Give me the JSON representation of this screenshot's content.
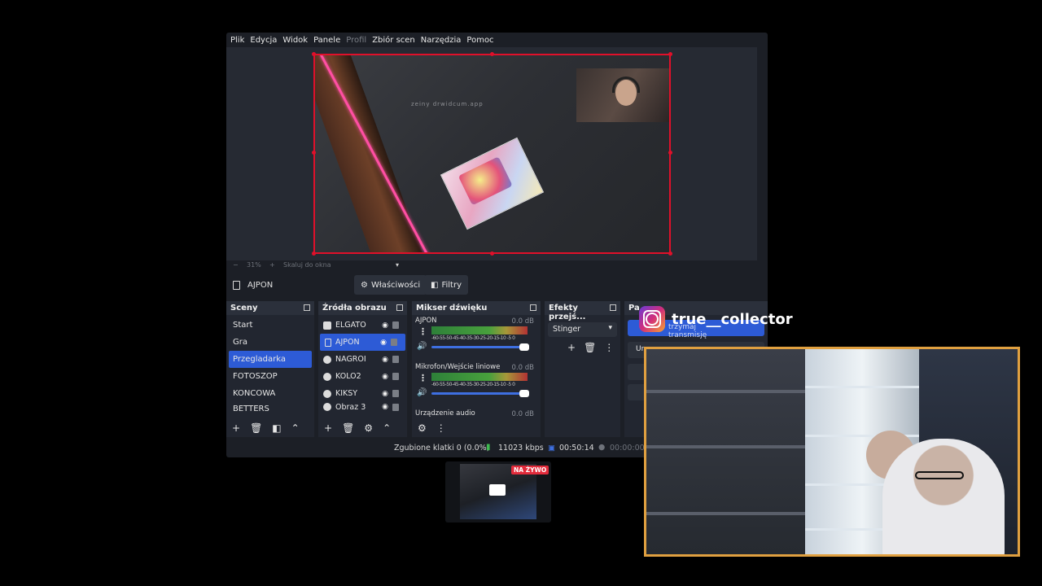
{
  "menu": [
    "Plik",
    "Edycja",
    "Widok",
    "Panele",
    "Profil",
    "Zbiór scen",
    "Narzędzia",
    "Pomoc"
  ],
  "preview": {
    "watermark": "zeiny drwidcum.app",
    "zoom_percent": "31%",
    "scale_label": "Skaluj do okna"
  },
  "source_bar": {
    "selected_source": "AJPON",
    "properties_label": "Właściwości",
    "filters_label": "Filtry"
  },
  "scenes": {
    "title": "Sceny",
    "items": [
      "Start",
      "Gra",
      "Przegladarka",
      "FOTOSZOP",
      "KONCOWA",
      "BETTERS"
    ],
    "selected": "Przegladarka"
  },
  "sources": {
    "title": "Źródła obrazu",
    "items": [
      "ELGATO",
      "AJPON",
      "NAGROI",
      "KOLO2",
      "KIKSY",
      "Obraz 3"
    ],
    "selected": "AJPON"
  },
  "mixer": {
    "title": "Mikser dźwięku",
    "channels": [
      {
        "name": "AJPON",
        "db": "0.0 dB",
        "ticks": "-60-55-50-45-40-35-30-25-20-15-10 -5 0"
      },
      {
        "name": "Mikrofon/Wejście liniowe",
        "db": "0.0 dB",
        "ticks": "-60-55-50-45-40-35-30-25-20-15-10 -5 0"
      },
      {
        "name": "Urządzenie audio",
        "db": "0.0 dB"
      }
    ]
  },
  "transitions": {
    "title": "Efekty przejś...",
    "selected": "Stinger"
  },
  "controls": {
    "title_partial": "Pa",
    "start_label_partial": "trzymaj transmisję",
    "other_partial": "Ur"
  },
  "status": {
    "dropped": "Zgubione klatki 0 (0.0%)",
    "bitrate": "11023 kbps",
    "live_time": "00:50:14",
    "rec_time": "00:00:00"
  },
  "overlay": {
    "instagram_handle": "true__collector",
    "live_badge": "NA ŻYWO"
  },
  "colors": {
    "selection": "#2d5bd6",
    "bounding_box": "#e0102a",
    "webcam_border": "#e0a040"
  }
}
